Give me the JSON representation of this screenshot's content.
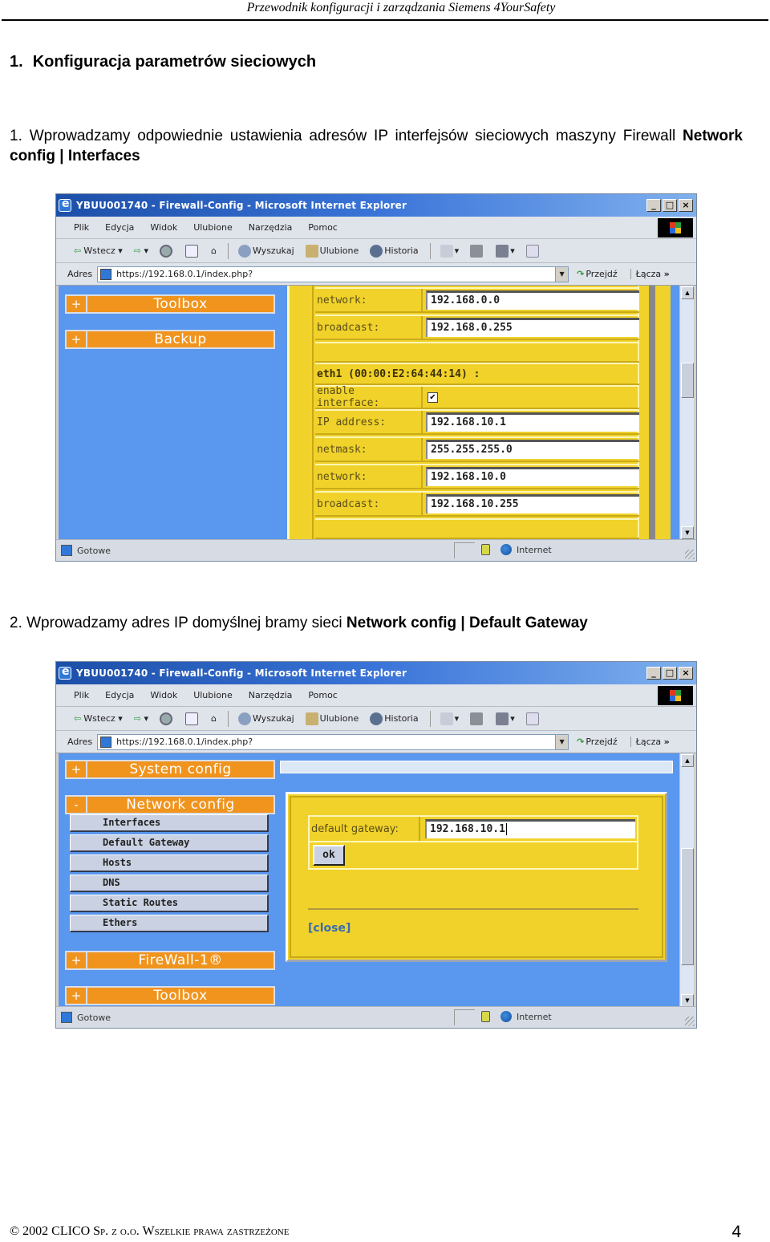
{
  "page": {
    "running_head": "Przewodnik konfiguracji i zarządzania Siemens 4YourSafety",
    "section_number": "1.",
    "section_title": "Konfiguracja parametrów sieciowych",
    "step1": {
      "text": "1. Wprowadzamy odpowiednie ustawienia adresów IP interfejsów sieciowych maszyny Firewall ",
      "bold": "Network config | Interfaces"
    },
    "step2": {
      "text": "2. Wprowadzamy adres IP domyślnej bramy sieci ",
      "bold": "Network config | Default Gateway"
    },
    "footer": {
      "copyright": "© 2002 CLICO Sp. z o.o. Wszelkie prawa zastrzeżone",
      "page_number": "4"
    }
  },
  "browser": {
    "title": "YBUU001740 - Firewall-Config - Microsoft Internet Explorer",
    "window_buttons": {
      "minimize": "_",
      "maximize": "□",
      "close": "×"
    },
    "menu": [
      "Plik",
      "Edycja",
      "Widok",
      "Ulubione",
      "Narzędzia",
      "Pomoc"
    ],
    "toolbar": {
      "back": "Wstecz",
      "search": "Wyszukaj",
      "favorites": "Ulubione",
      "history": "Historia"
    },
    "address_label": "Adres",
    "address_value": "https://192.168.0.1/index.php?",
    "go_label": "Przejdź",
    "links_label": "Łącza",
    "links_more": "»",
    "status_text": "Gotowe",
    "zone_text": "Internet"
  },
  "screenshot1": {
    "nav": [
      {
        "toggle": "+",
        "label": "Toolbox"
      },
      {
        "toggle": "+",
        "label": "Backup"
      }
    ],
    "form": {
      "rows": [
        {
          "label": "network:",
          "value": "192.168.0.0"
        },
        {
          "label": "broadcast:",
          "value": "192.168.0.255"
        }
      ],
      "interface_heading": "eth1 (00:00:E2:64:44:14) :",
      "enable_label": "enable interface:",
      "enable_checked": true,
      "check_glyph": "✔",
      "rows2": [
        {
          "label": "IP address:",
          "value": "192.168.10.1"
        },
        {
          "label": "netmask:",
          "value": "255.255.255.0"
        },
        {
          "label": "network:",
          "value": "192.168.10.0"
        },
        {
          "label": "broadcast:",
          "value": "192.168.10.255"
        }
      ]
    }
  },
  "screenshot2": {
    "nav_top": {
      "toggle": "+",
      "label": "System config"
    },
    "nav_network": {
      "toggle": "-",
      "label": "Network config"
    },
    "subnav": [
      "Interfaces",
      "Default Gateway",
      "Hosts",
      "DNS",
      "Static Routes",
      "Ethers"
    ],
    "nav_bottom": [
      {
        "toggle": "+",
        "label": "FireWall-1®"
      },
      {
        "toggle": "+",
        "label": "Toolbox"
      }
    ],
    "dialog": {
      "gateway_label": "default gateway:",
      "gateway_value": "192.168.10.1",
      "ok_label": "ok",
      "close_label": "[close]"
    }
  }
}
